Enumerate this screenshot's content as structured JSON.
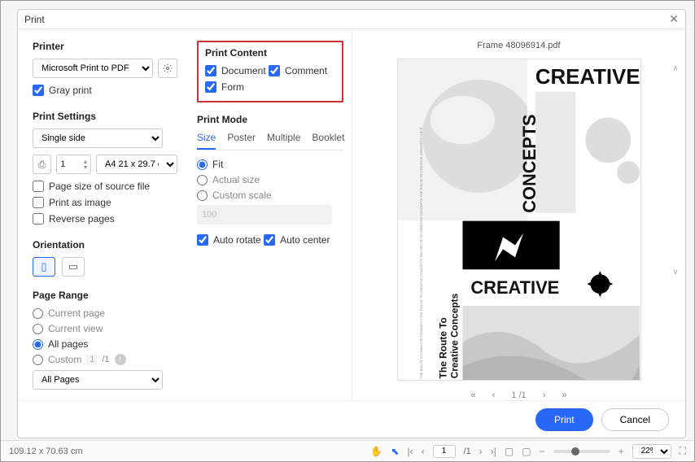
{
  "dialog": {
    "title": "Print"
  },
  "printer": {
    "section": "Printer",
    "selected": "Microsoft Print to PDF",
    "gray_print": "Gray print"
  },
  "settings": {
    "section": "Print Settings",
    "sides": "Single side",
    "copies": "1",
    "paper": "A4 21 x 29.7 cm",
    "source_file": "Page size of source file",
    "as_image": "Print as image",
    "reverse": "Reverse pages"
  },
  "orientation": {
    "section": "Orientation"
  },
  "range": {
    "section": "Page Range",
    "current_page": "Current page",
    "current_view": "Current view",
    "all_pages": "All pages",
    "custom": "Custom",
    "custom_value": "1-1",
    "total": "/1",
    "filter": "All Pages"
  },
  "content": {
    "section": "Print Content",
    "document": "Document",
    "comment": "Comment",
    "form": "Form"
  },
  "mode": {
    "section": "Print Mode",
    "tabs": {
      "size": "Size",
      "poster": "Poster",
      "multiple": "Multiple",
      "booklet": "Booklet"
    },
    "fit": "Fit",
    "actual": "Actual size",
    "custom_scale": "Custom scale",
    "scale_value": "100",
    "auto_rotate": "Auto rotate",
    "auto_center": "Auto center"
  },
  "preview": {
    "filename": "Frame 48096914.pdf",
    "page_current": "1",
    "page_total": "/1"
  },
  "footer": {
    "print": "Print",
    "cancel": "Cancel"
  },
  "statusbar": {
    "dimensions": "109.12 x 70.63 cm",
    "page": "1",
    "page_total": "/1",
    "zoom": "22%"
  },
  "art": {
    "creative1": "CREATIVE",
    "concepts": "CONCEPTS",
    "creative2": "CREATIVE",
    "route": "The Route To",
    "cc": "Creative Concepts"
  }
}
